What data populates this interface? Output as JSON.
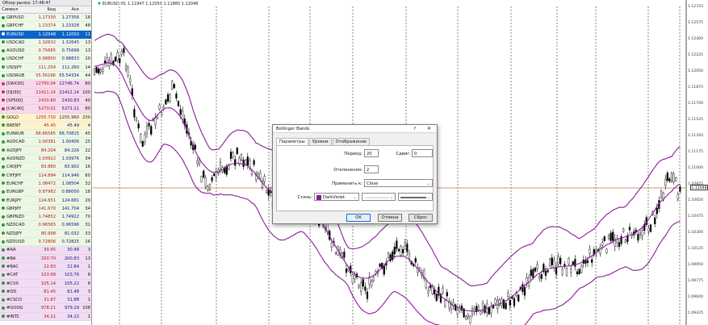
{
  "market_watch": {
    "title": "Обзор рынка: 17:48:47",
    "columns": {
      "symbol": "Символ",
      "bid": "Бид",
      "ask": "Аск",
      "spread": ""
    },
    "rows": [
      {
        "symbol": "GBPUSD",
        "bid": "1.27330",
        "ask": "1.27356",
        "spread": "18",
        "group": "g-fx"
      },
      {
        "symbol": "GBPCHF",
        "bid": "1.23374",
        "ask": "1.23328",
        "spread": "48",
        "group": "g-fx"
      },
      {
        "symbol": "EURUSD",
        "bid": "1.12048",
        "ask": "1.12050",
        "spread": "11",
        "group": "selected"
      },
      {
        "symbol": "USDCAD",
        "bid": "1.32632",
        "ask": "1.32645",
        "spread": "13",
        "group": "g-fx"
      },
      {
        "symbol": "AUDUSD",
        "bid": "0.75685",
        "ask": "0.75698",
        "spread": "13",
        "group": "g-fx"
      },
      {
        "symbol": "USDCHF",
        "bid": "0.98800",
        "ask": "0.98833",
        "spread": "20",
        "group": "g-fx"
      },
      {
        "symbol": "USDJPY",
        "bid": "111.254",
        "ask": "111.260",
        "spread": "14",
        "group": "g-fx"
      },
      {
        "symbol": "USDRUB",
        "bid": "55.56166",
        "ask": "55.54334",
        "spread": "44",
        "group": "g-fx"
      },
      {
        "symbol": "[DAX30]",
        "bid": "12700.04",
        "ask": "12746.74",
        "spread": "80",
        "group": "g-idx"
      },
      {
        "symbol": "[DJI30]",
        "bid": "21411.14",
        "ask": "21412.14",
        "spread": "100",
        "group": "g-idx"
      },
      {
        "symbol": "[SP500]",
        "bid": "2430.80",
        "ask": "2430.83",
        "spread": "40",
        "group": "g-idx"
      },
      {
        "symbol": "[CAC40]",
        "bid": "5270.01",
        "ask": "5271.11",
        "spread": "80",
        "group": "g-idx"
      },
      {
        "symbol": "GOLD",
        "bid": "1255.730",
        "ask": "1255.960",
        "spread": "230",
        "group": "g-com"
      },
      {
        "symbol": "BRENT",
        "bid": "45.45",
        "ask": "45.49",
        "spread": "4",
        "group": "g-com"
      },
      {
        "symbol": "EURRUB",
        "bid": "66.66585",
        "ask": "66.70815",
        "spread": "45",
        "group": "g-fx2"
      },
      {
        "symbol": "AUDCAD",
        "bid": "1.00381",
        "ask": "1.00406",
        "spread": "25",
        "group": "g-fx2"
      },
      {
        "symbol": "AUDJPY",
        "bid": "84.204",
        "ask": "84.226",
        "spread": "22",
        "group": "g-fx2"
      },
      {
        "symbol": "AUDNZD",
        "bid": "1.03922",
        "ask": "1.03976",
        "spread": "34",
        "group": "g-fx2"
      },
      {
        "symbol": "CADJPY",
        "bid": "83.880",
        "ask": "83.902",
        "spread": "16",
        "group": "g-fx2"
      },
      {
        "symbol": "CHFJPY",
        "bid": "114.894",
        "ask": "114.946",
        "spread": "60",
        "group": "g-fx2"
      },
      {
        "symbol": "EURCHF",
        "bid": "1.08472",
        "ask": "1.08504",
        "spread": "32",
        "group": "g-fx2"
      },
      {
        "symbol": "EURGBP",
        "bid": "0.87982",
        "ask": "0.88000",
        "spread": "18",
        "group": "g-fx2"
      },
      {
        "symbol": "EURJPY",
        "bid": "124.651",
        "ask": "124.681",
        "spread": "20",
        "group": "g-fx2"
      },
      {
        "symbol": "GBPJPY",
        "bid": "141.670",
        "ask": "141.704",
        "spread": "34",
        "group": "g-fx2"
      },
      {
        "symbol": "GBPNZD",
        "bid": "1.74852",
        "ask": "1.74922",
        "spread": "70",
        "group": "g-fx2"
      },
      {
        "symbol": "NZDCAD",
        "bid": "0.96565",
        "ask": "0.96596",
        "spread": "31",
        "group": "g-fx2"
      },
      {
        "symbol": "NZDJPY",
        "bid": "80.998",
        "ask": "81.032",
        "spread": "33",
        "group": "g-fx2"
      },
      {
        "symbol": "NZDUSD",
        "bid": "0.72806",
        "ask": "0.72825",
        "spread": "16",
        "group": "g-fx2"
      },
      {
        "symbol": "#AA",
        "bid": "30.45",
        "ask": "30.48",
        "spread": "3",
        "group": "g-stk"
      },
      {
        "symbol": "#BA",
        "bid": "200.70",
        "ask": "200.83",
        "spread": "13",
        "group": "g-stk"
      },
      {
        "symbol": "#BAC",
        "bid": "22.83",
        "ask": "22.84",
        "spread": "1",
        "group": "g-stk"
      },
      {
        "symbol": "#CAT",
        "bid": "103.68",
        "ask": "103.76",
        "spread": "8",
        "group": "g-stk"
      },
      {
        "symbol": "#CVX",
        "bid": "105.14",
        "ask": "105.22",
        "spread": "8",
        "group": "g-stk"
      },
      {
        "symbol": "#DD",
        "bid": "81.45",
        "ask": "81.48",
        "spread": "3",
        "group": "g-stk"
      },
      {
        "symbol": "#CSCO",
        "bid": "31.87",
        "ask": "31.88",
        "spread": "1",
        "group": "g-stk"
      },
      {
        "symbol": "#GOOG",
        "bid": "978.21",
        "ask": "979.29",
        "spread": "108",
        "group": "g-stk"
      },
      {
        "symbol": "#INTC",
        "bid": "34.21",
        "ask": "34.22",
        "spread": "1",
        "group": "g-stk"
      }
    ]
  },
  "chart": {
    "header": "EURUSD,H1  1.11947 1.12050 1.11880 1.12048",
    "current_price": "1.12048",
    "price_axis": [
      "1.12743",
      "1.12575",
      "1.12400",
      "1.12225",
      "1.12050",
      "1.11875",
      "1.11700",
      "1.11525",
      "1.11350",
      "1.11175",
      "1.11000",
      "1.10825",
      "1.10650",
      "1.10475",
      "1.10300",
      "1.10125",
      "1.09950",
      "1.09775",
      "1.09600",
      "1.09425"
    ],
    "colors": {
      "candle": "#000000",
      "bands": "#8b1a9a",
      "price_line": "#c87040",
      "grid": "#333333"
    }
  },
  "dialog": {
    "title": "Bollinger Bands",
    "help": "?",
    "close": "✕",
    "tabs": [
      "Параметры",
      "Уровни",
      "Отображение"
    ],
    "active_tab": 0,
    "period_label": "Период:",
    "period_value": "20",
    "shift_label": "Сдвиг:",
    "shift_value": "0",
    "deviations_label": "Отклонения:",
    "deviations_value": "2",
    "apply_label": "Применить к:",
    "apply_value": "Close",
    "style_label": "Стиль:",
    "style_color_name": "DarkViolet",
    "style_color": "#8a1a9a",
    "ok_label": "ОК",
    "cancel_label": "Отмена",
    "reset_label": "Сброс"
  }
}
